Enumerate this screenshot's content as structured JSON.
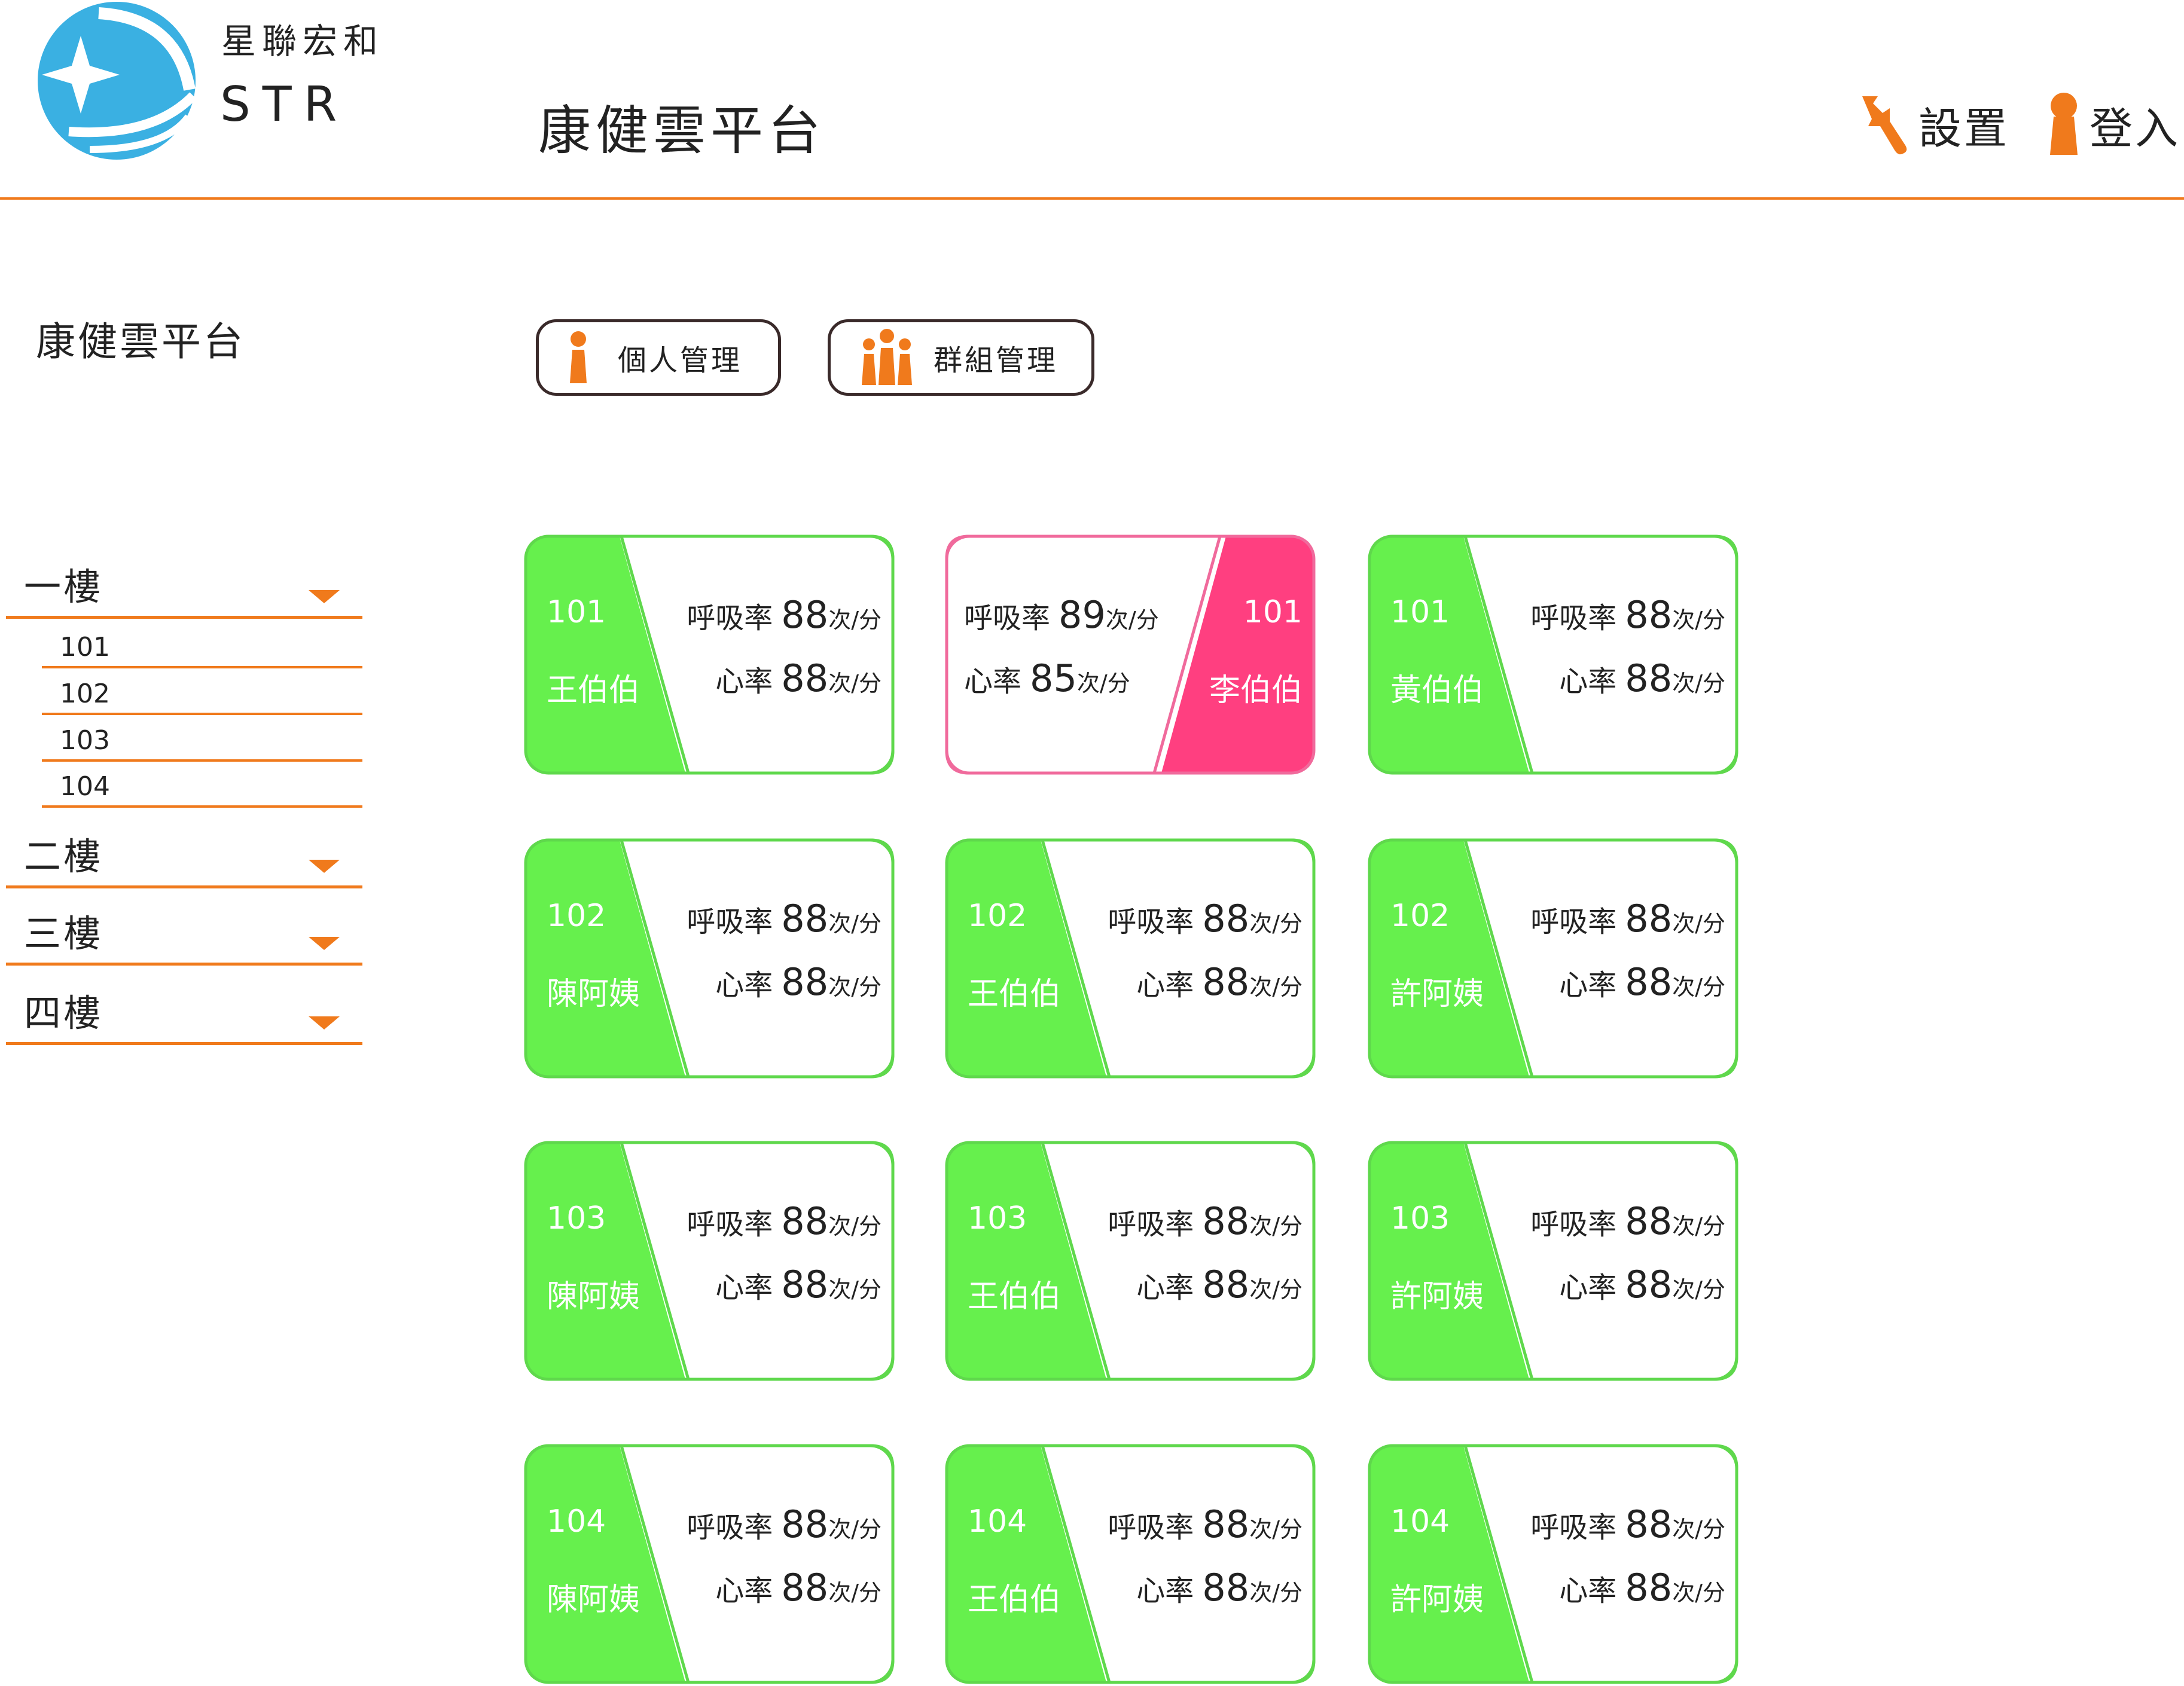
{
  "brand": {
    "name_cn": "星聯宏和",
    "name_en": "STR"
  },
  "header": {
    "title": "康健雲平台",
    "settings_label": "設置",
    "login_label": "登入"
  },
  "colors": {
    "accent": "#f07a1c",
    "normal": "#66f04d",
    "normal_border": "#5fd84c",
    "alert": "#ff3f80",
    "alert_border": "#f06a9c"
  },
  "sidebar": {
    "title": "康健雲平台",
    "floors": [
      {
        "label": "一樓",
        "rooms": [
          "101",
          "102",
          "103",
          "104"
        ]
      },
      {
        "label": "二樓"
      },
      {
        "label": "三樓"
      },
      {
        "label": "四樓"
      }
    ]
  },
  "actions": {
    "personal": "個人管理",
    "group": "群組管理"
  },
  "metric_labels": {
    "resp": "呼吸率",
    "heart": "心率",
    "unit": "次/分"
  },
  "residents": [
    {
      "room": "101",
      "name": "王伯伯",
      "resp": "88",
      "heart": "88",
      "status": "normal"
    },
    {
      "room": "101",
      "name": "李伯伯",
      "resp": "89",
      "heart": "85",
      "status": "alert"
    },
    {
      "room": "101",
      "name": "黃伯伯",
      "resp": "88",
      "heart": "88",
      "status": "normal"
    },
    {
      "room": "102",
      "name": "陳阿姨",
      "resp": "88",
      "heart": "88",
      "status": "normal"
    },
    {
      "room": "102",
      "name": "王伯伯",
      "resp": "88",
      "heart": "88",
      "status": "normal"
    },
    {
      "room": "102",
      "name": "許阿姨",
      "resp": "88",
      "heart": "88",
      "status": "normal"
    },
    {
      "room": "103",
      "name": "陳阿姨",
      "resp": "88",
      "heart": "88",
      "status": "normal"
    },
    {
      "room": "103",
      "name": "王伯伯",
      "resp": "88",
      "heart": "88",
      "status": "normal"
    },
    {
      "room": "103",
      "name": "許阿姨",
      "resp": "88",
      "heart": "88",
      "status": "normal"
    },
    {
      "room": "104",
      "name": "陳阿姨",
      "resp": "88",
      "heart": "88",
      "status": "normal"
    },
    {
      "room": "104",
      "name": "王伯伯",
      "resp": "88",
      "heart": "88",
      "status": "normal"
    },
    {
      "room": "104",
      "name": "許阿姨",
      "resp": "88",
      "heart": "88",
      "status": "normal"
    }
  ]
}
